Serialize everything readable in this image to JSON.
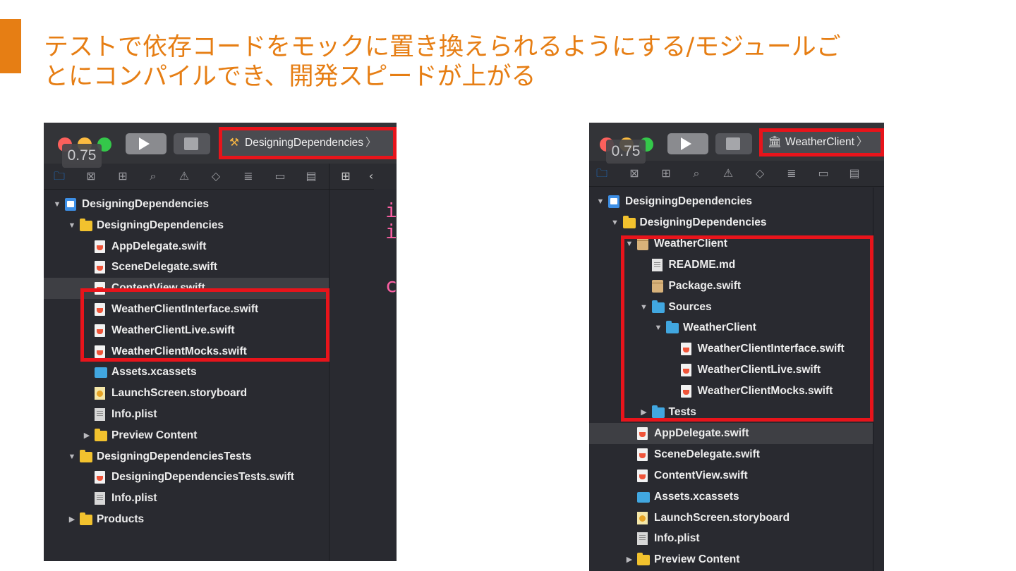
{
  "slide": {
    "accent_color": "#e67e14",
    "title_line1": "テストで依存コードをモックに置き換えられるようにする/モジュールご",
    "title_line2": "とにコンパイルでき、開発スピードが上がる"
  },
  "left_panel": {
    "zoom_readout": "0.75",
    "scheme_name": "DesigningDependencies",
    "scheme_icon": "xcode-app-icon",
    "editor_chars": [
      "i",
      "i",
      "c"
    ],
    "tree": [
      {
        "label": "DesigningDependencies",
        "icon": "project-icon",
        "level": 0,
        "disclosure": "open"
      },
      {
        "label": "DesigningDependencies",
        "icon": "folder-icon",
        "level": 1,
        "disclosure": "open"
      },
      {
        "label": "AppDelegate.swift",
        "icon": "swift-file-icon",
        "level": 2
      },
      {
        "label": "SceneDelegate.swift",
        "icon": "swift-file-icon",
        "level": 2
      },
      {
        "label": "ContentView.swift",
        "icon": "swift-file-icon",
        "level": 2
      },
      {
        "label": "WeatherClientInterface.swift",
        "icon": "swift-file-icon",
        "level": 2
      },
      {
        "label": "WeatherClientLive.swift",
        "icon": "swift-file-icon",
        "level": 2
      },
      {
        "label": "WeatherClientMocks.swift",
        "icon": "swift-file-icon",
        "level": 2
      },
      {
        "label": "Assets.xcassets",
        "icon": "assets-icon",
        "level": 2
      },
      {
        "label": "LaunchScreen.storyboard",
        "icon": "storyboard-icon",
        "level": 2
      },
      {
        "label": "Info.plist",
        "icon": "plist-icon",
        "level": 2
      },
      {
        "label": "Preview Content",
        "icon": "folder-icon",
        "level": 2,
        "disclosure": "closed"
      },
      {
        "label": "DesigningDependenciesTests",
        "icon": "folder-icon",
        "level": 1,
        "disclosure": "open"
      },
      {
        "label": "DesigningDependenciesTests.swift",
        "icon": "swift-file-icon",
        "level": 2
      },
      {
        "label": "Info.plist",
        "icon": "plist-icon",
        "level": 2
      },
      {
        "label": "Products",
        "icon": "folder-icon",
        "level": 1,
        "disclosure": "closed"
      }
    ]
  },
  "right_panel": {
    "zoom_readout": "0.75",
    "scheme_name": "WeatherClient",
    "scheme_icon": "library-icon",
    "tree": [
      {
        "label": "DesigningDependencies",
        "icon": "project-icon",
        "level": 0,
        "disclosure": "open"
      },
      {
        "label": "DesigningDependencies",
        "icon": "folder-icon",
        "level": 1,
        "disclosure": "open"
      },
      {
        "label": "WeatherClient",
        "icon": "package-icon",
        "level": 2,
        "disclosure": "open"
      },
      {
        "label": "README.md",
        "icon": "document-icon",
        "level": 3
      },
      {
        "label": "Package.swift",
        "icon": "package-icon",
        "level": 3
      },
      {
        "label": "Sources",
        "icon": "blue-folder-icon",
        "level": 3,
        "disclosure": "open"
      },
      {
        "label": "WeatherClient",
        "icon": "blue-folder-icon",
        "level": 4,
        "disclosure": "open"
      },
      {
        "label": "WeatherClientInterface.swift",
        "icon": "swift-file-icon",
        "level": 5
      },
      {
        "label": "WeatherClientLive.swift",
        "icon": "swift-file-icon",
        "level": 5
      },
      {
        "label": "WeatherClientMocks.swift",
        "icon": "swift-file-icon",
        "level": 5
      },
      {
        "label": "Tests",
        "icon": "blue-folder-icon",
        "level": 3,
        "disclosure": "closed"
      },
      {
        "label": "AppDelegate.swift",
        "icon": "swift-file-icon",
        "level": 2
      },
      {
        "label": "SceneDelegate.swift",
        "icon": "swift-file-icon",
        "level": 2
      },
      {
        "label": "ContentView.swift",
        "icon": "swift-file-icon",
        "level": 2
      },
      {
        "label": "Assets.xcassets",
        "icon": "assets-icon",
        "level": 2
      },
      {
        "label": "LaunchScreen.storyboard",
        "icon": "storyboard-icon",
        "level": 2
      },
      {
        "label": "Info.plist",
        "icon": "plist-icon",
        "level": 2
      },
      {
        "label": "Preview Content",
        "icon": "folder-icon",
        "level": 2,
        "disclosure": "closed"
      }
    ]
  },
  "colors": {
    "highlight_red": "#e8141b",
    "sidebar_bg": "#292a30",
    "selection_bg": "#3e3f44",
    "active_nav_blue": "#1a8cff"
  }
}
